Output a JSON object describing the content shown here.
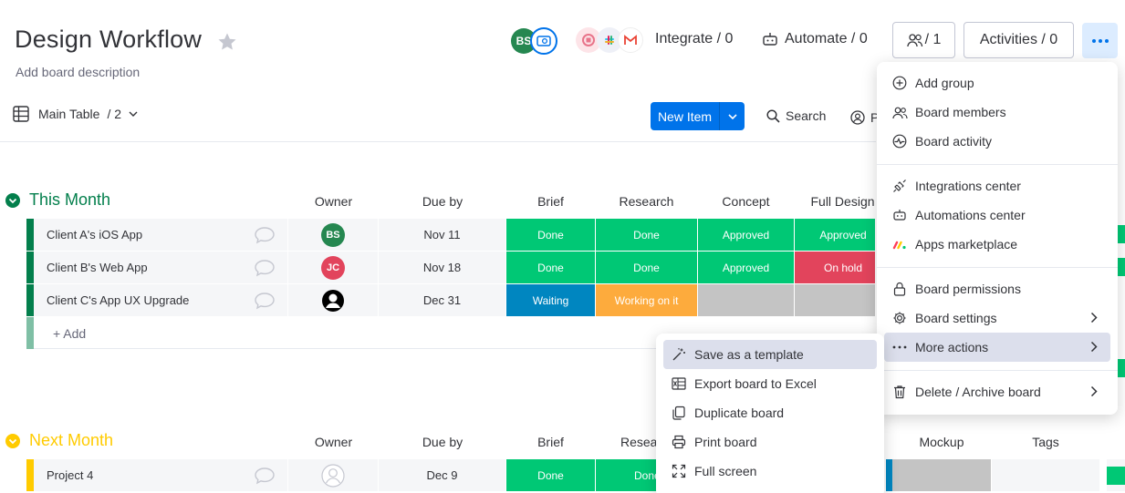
{
  "header": {
    "title": "Design Workflow",
    "description": "Add board description",
    "member_initials": "BS",
    "integrate_label": "Integrate / 0",
    "automate_label": "Automate / 0",
    "members_count": "/ 1",
    "activities_label": "Activities / 0"
  },
  "toolbar": {
    "view_label": "Main Table",
    "view_count": "/ 2",
    "new_item_label": "New Item",
    "search_label": "Search",
    "person_label_partial": "P"
  },
  "columns": [
    "Owner",
    "Due by",
    "Brief",
    "Research",
    "Concept",
    "Full Design",
    "Mockup",
    "Tags"
  ],
  "groups": [
    {
      "name": "This Month",
      "color": "#037f4c",
      "rows": [
        {
          "name": "Client A's iOS App",
          "owner": "BS",
          "owner_color": "#258750",
          "due": "Nov 11",
          "brief": "Done",
          "research": "Done",
          "concept": "Approved",
          "full_design": "Approved"
        },
        {
          "name": "Client B's Web App",
          "owner": "JC",
          "owner_color": "#e2445c",
          "due": "Nov 18",
          "brief": "Done",
          "research": "Done",
          "concept": "Approved",
          "full_design": "On hold"
        },
        {
          "name": "Client C's App UX Upgrade",
          "owner": "",
          "owner_color": "#000000",
          "due": "Dec 31",
          "brief": "Waiting",
          "research": "Working on it",
          "concept": "",
          "full_design": ""
        }
      ],
      "add_label": "+ Add"
    },
    {
      "name": "Next Month",
      "color": "#ffcb00",
      "rows": [
        {
          "name": "Project 4",
          "owner": "",
          "due": "Dec 9",
          "brief": "Done",
          "research": "Done"
        }
      ]
    }
  ],
  "status_colors": {
    "done": "#00c875",
    "approved": "#00c875",
    "on_hold": "#e2445c",
    "waiting": "#0086c0",
    "working": "#fdab3d",
    "empty": "#c4c4c4"
  },
  "main_menu": {
    "items": [
      {
        "label": "Add group",
        "icon": "plus-circle-icon"
      },
      {
        "label": "Board members",
        "icon": "members-icon"
      },
      {
        "label": "Board activity",
        "icon": "activity-icon"
      },
      {
        "label": "Integrations center",
        "icon": "plug-icon"
      },
      {
        "label": "Automations center",
        "icon": "robot-icon"
      },
      {
        "label": "Apps marketplace",
        "icon": "apps-logo-icon"
      },
      {
        "label": "Board permissions",
        "icon": "lock-icon"
      },
      {
        "label": "Board settings",
        "icon": "gear-icon"
      },
      {
        "label": "More actions",
        "icon": "ellipsis-icon"
      },
      {
        "label": "Delete / Archive board",
        "icon": "trash-icon"
      }
    ]
  },
  "sub_menu": {
    "items": [
      {
        "label": "Save as a template",
        "icon": "magic-wand-icon"
      },
      {
        "label": "Export board to Excel",
        "icon": "excel-icon"
      },
      {
        "label": "Duplicate board",
        "icon": "duplicate-icon"
      },
      {
        "label": "Print board",
        "icon": "printer-icon"
      },
      {
        "label": "Full screen",
        "icon": "fullscreen-icon"
      }
    ]
  }
}
